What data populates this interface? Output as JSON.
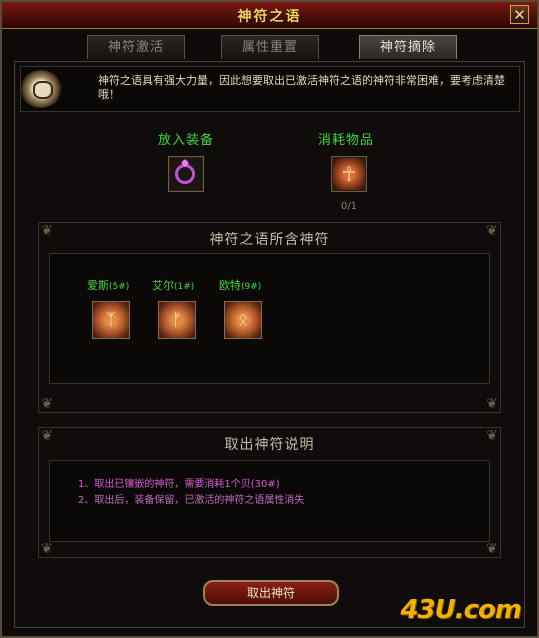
{
  "window": {
    "title": "神符之语",
    "close_glyph": "✕"
  },
  "tabs": [
    {
      "label": "神符激活",
      "active": false
    },
    {
      "label": "属性重置",
      "active": false
    },
    {
      "label": "神符摘除",
      "active": true
    }
  ],
  "notice": {
    "icon": "seal-icon",
    "text": "神符之语具有强大力量，因此想要取出已激活神符之语的神符非常困难，要考虑清楚哦！"
  },
  "slots": {
    "equipment": {
      "label": "放入装备",
      "icon": "ring-icon"
    },
    "consumable": {
      "label": "消耗物品",
      "icon": "ankh-rune-icon",
      "count": "0/1"
    }
  },
  "runes_section": {
    "title": "神符之语所含神符",
    "runes": [
      {
        "name": "爱斯",
        "num": "(5#)",
        "glyph": "ᛉ"
      },
      {
        "name": "艾尔",
        "num": "(1#)",
        "glyph": "ᚠ"
      },
      {
        "name": "欧特",
        "num": "(9#)",
        "glyph": "ᛟ"
      }
    ]
  },
  "instructions": {
    "title": "取出神符说明",
    "lines": [
      "1、取出已镶嵌的神符，需要消耗1个贝(30#)",
      "2、取出后，装备保留，已激活的神符之语属性消失"
    ]
  },
  "button": {
    "label": "取出神符"
  },
  "watermark": "43U.com",
  "colors": {
    "title": "#f5d25a",
    "green_label": "#3fd63a",
    "desc_pink": "#d95ad6",
    "button_red": "#8b1f14"
  }
}
